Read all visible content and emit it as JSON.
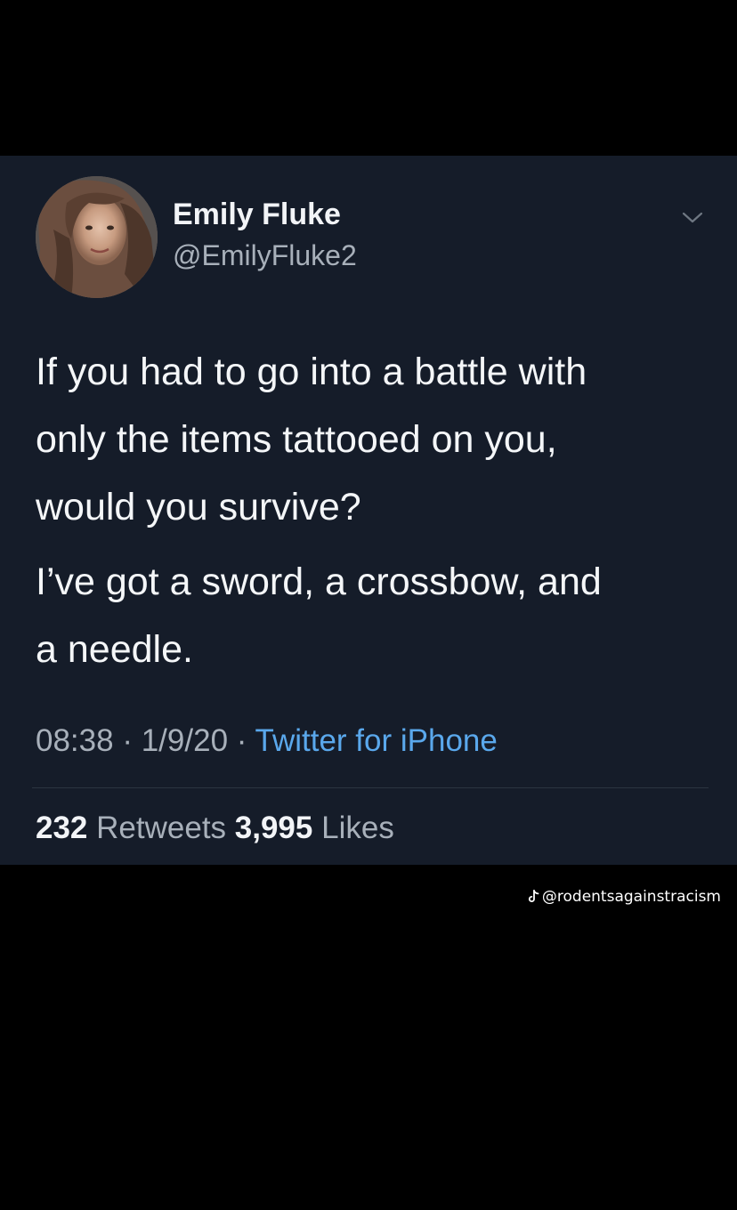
{
  "tweet": {
    "author": {
      "display_name": "Emily Fluke",
      "handle": "@EmilyFluke2"
    },
    "text": [
      "If you had to go into a battle with\nonly the items tattooed on you,\nwould you survive?",
      "I’ve got a sword, a crossbow, and\na needle."
    ],
    "time": "08:38",
    "separator": "·",
    "date": "1/9/20",
    "source": "Twitter for iPhone",
    "retweets_count": "232",
    "retweets_label": "Retweets",
    "likes_count": "3,995",
    "likes_label": "Likes",
    "icons": {
      "menu": "chevron-down-icon",
      "watermark": "tiktok-icon"
    }
  },
  "watermark": {
    "text": "@rodentsagainstracism"
  },
  "colors": {
    "background": "#000000",
    "card": "#151c29",
    "primary_text": "#f2f4f7",
    "secondary_text": "#a8b0ba",
    "link": "#5aa8ec"
  }
}
